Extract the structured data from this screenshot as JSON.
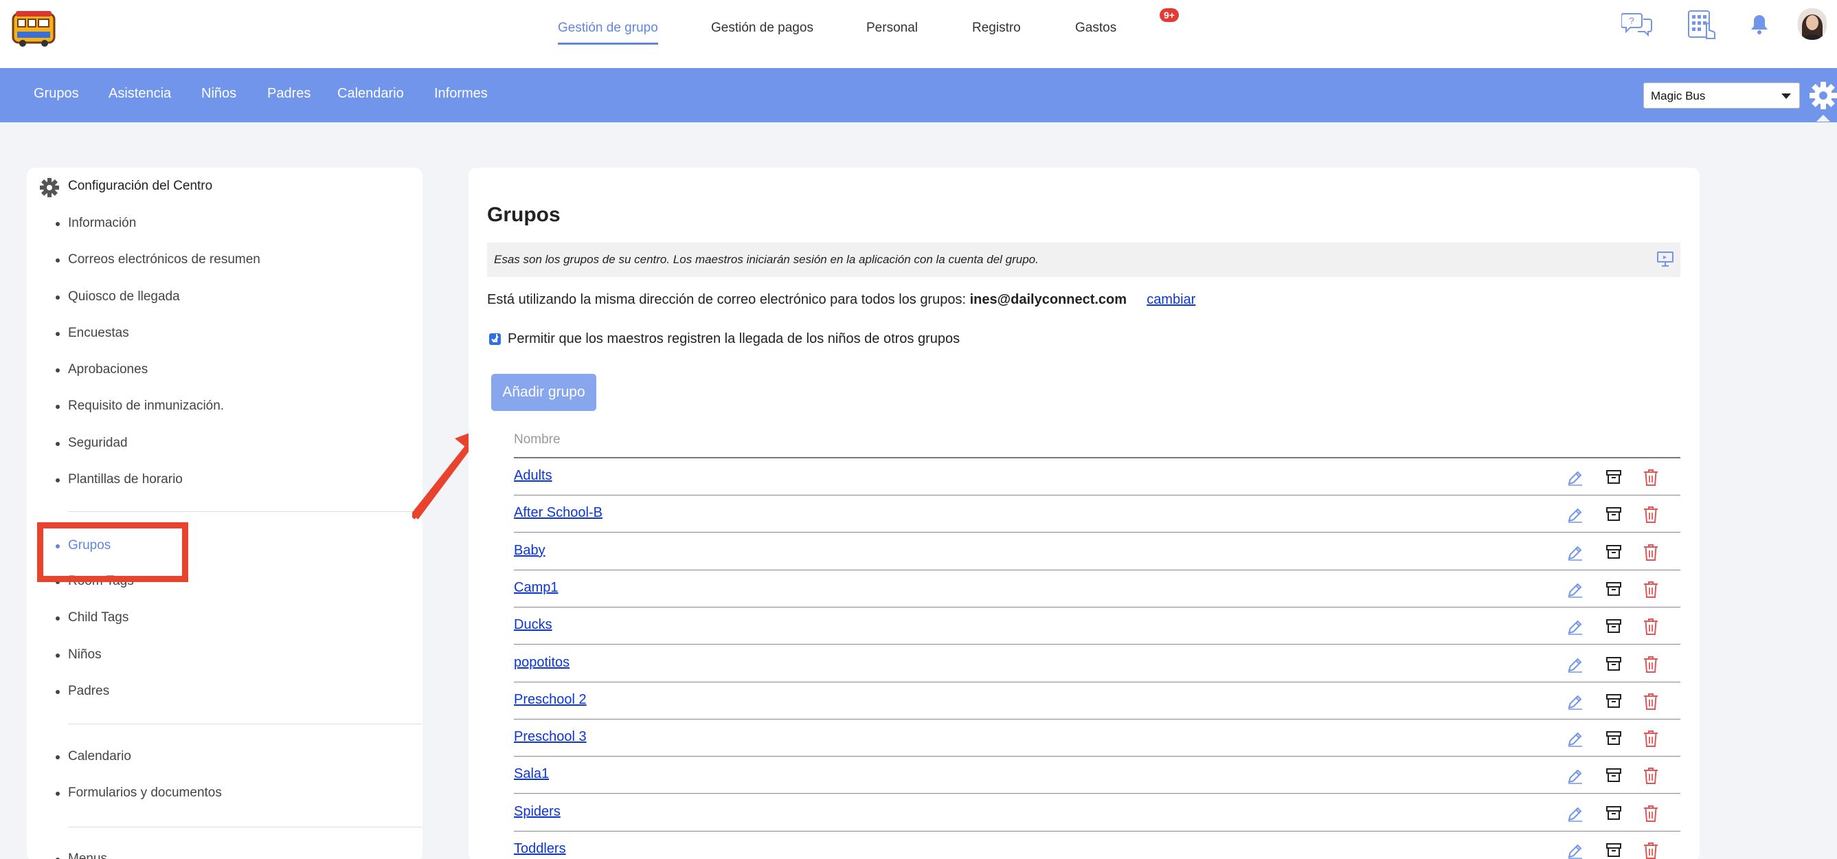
{
  "header": {
    "nav": [
      "Gestión de grupo",
      "Gestión de pagos",
      "Personal",
      "Registro",
      "Gastos"
    ],
    "active_nav": "Gestión de grupo",
    "notification_badge": "9+",
    "icons": [
      "help-chat-icon",
      "kiosk-keypad-icon",
      "bell-icon"
    ]
  },
  "subnav": {
    "items": [
      "Grupos",
      "Asistencia",
      "Niños",
      "Padres",
      "Calendario",
      "Informes"
    ],
    "center_select": "Magic Bus"
  },
  "sidebar": {
    "title": "Configuración del Centro",
    "items": [
      "Información",
      "Correos electrónicos de resumen",
      "Quiosco de llegada",
      "Encuestas",
      "Aprobaciones",
      "Requisito de inmunización.",
      "Seguridad",
      "Plantillas de horario",
      "Grupos",
      "Room Tags",
      "Child Tags",
      "Niños",
      "Padres",
      "Calendario",
      "Formularios y documentos",
      "Menus"
    ],
    "active_item": "Grupos"
  },
  "main": {
    "title": "Grupos",
    "info_text": "Esas son los grupos de su centro. Los maestros iniciarán sesión en la aplicación con la cuenta del grupo.",
    "email_prefix": "Está utilizando la misma dirección de correo electrónico para todos los grupos:",
    "email": "ines@dailyconnect.com",
    "change_link": "cambiar",
    "checkbox_label": "Permitir que los maestros registren la llegada de los niños de otros grupos",
    "checkbox_checked": true,
    "add_button": "Añadir grupo",
    "table_header": "Nombre",
    "groups": [
      "Adults",
      "After School-B",
      "Baby",
      "Camp1",
      "Ducks",
      "popotitos",
      "Preschool 2",
      "Preschool 3",
      "Sala1",
      "Spiders",
      "Toddlers"
    ]
  },
  "colors": {
    "accent": "#5f86e0",
    "bluebar": "#7095ea",
    "annotation_red": "#e8432d",
    "delete_red": "#e25555",
    "link_blue": "#0a36d8"
  }
}
